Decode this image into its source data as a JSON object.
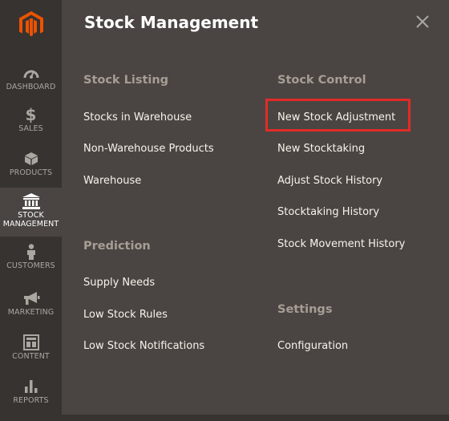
{
  "sidebar": {
    "items": [
      {
        "label": "DASHBOARD",
        "icon": "dashboard-icon"
      },
      {
        "label": "SALES",
        "icon": "dollar-icon"
      },
      {
        "label": "PRODUCTS",
        "icon": "box-icon"
      },
      {
        "label": "STOCK\nMANAGEMENT",
        "icon": "building-icon"
      },
      {
        "label": "CUSTOMERS",
        "icon": "person-icon"
      },
      {
        "label": "MARKETING",
        "icon": "megaphone-icon"
      },
      {
        "label": "CONTENT",
        "icon": "layout-icon"
      },
      {
        "label": "REPORTS",
        "icon": "bar-chart-icon"
      }
    ]
  },
  "panel": {
    "title": "Stock Management",
    "sections": {
      "stock_listing": {
        "title": "Stock Listing",
        "links": [
          "Stocks in Warehouse",
          "Non-Warehouse Products",
          "Warehouse"
        ]
      },
      "prediction": {
        "title": "Prediction",
        "links": [
          "Supply Needs",
          "Low Stock Rules",
          "Low Stock Notifications"
        ]
      },
      "stock_control": {
        "title": "Stock Control",
        "links": [
          "New Stock Adjustment",
          "New Stocktaking",
          "Adjust Stock History",
          "Stocktaking History",
          "Stock Movement History"
        ]
      },
      "settings": {
        "title": "Settings",
        "links": [
          "Configuration"
        ]
      }
    }
  },
  "colors": {
    "sidebar_bg": "#373330",
    "panel_bg": "#4a4542",
    "logo_orange": "#eb5202",
    "highlight_red": "#e02b27"
  }
}
